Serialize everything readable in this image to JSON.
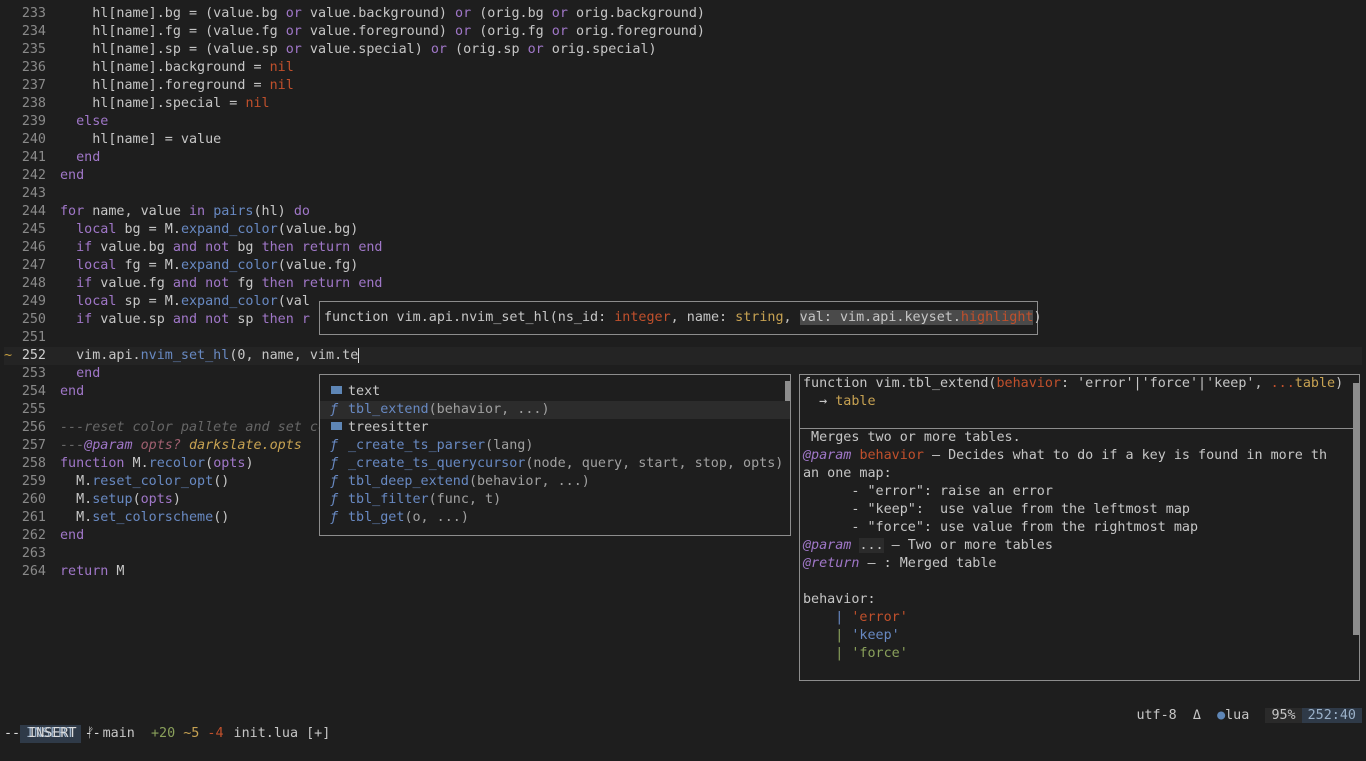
{
  "editor": {
    "lines": [
      {
        "n": "233",
        "html": "    hl[name].bg = (value.bg <span class=\"k\">or</span> value.background) <span class=\"k\">or</span> (orig.bg <span class=\"k\">or</span> orig.background)"
      },
      {
        "n": "234",
        "html": "    hl[name].fg = (value.fg <span class=\"k\">or</span> value.foreground) <span class=\"k\">or</span> (orig.fg <span class=\"k\">or</span> orig.foreground)"
      },
      {
        "n": "235",
        "html": "    hl[name].sp = (value.sp <span class=\"k\">or</span> value.special) <span class=\"k\">or</span> (orig.sp <span class=\"k\">or</span> orig.special)"
      },
      {
        "n": "236",
        "html": "    hl[name].background = <span class=\"b\">nil</span>"
      },
      {
        "n": "237",
        "html": "    hl[name].foreground = <span class=\"b\">nil</span>"
      },
      {
        "n": "238",
        "html": "    hl[name].special = <span class=\"b\">nil</span>"
      },
      {
        "n": "239",
        "html": "  <span class=\"k\">else</span>"
      },
      {
        "n": "240",
        "html": "    hl[name] = value"
      },
      {
        "n": "241",
        "html": "  <span class=\"k\">end</span>"
      },
      {
        "n": "242",
        "html": "<span class=\"k\">end</span>"
      },
      {
        "n": "243",
        "html": ""
      },
      {
        "n": "244",
        "html": "<span class=\"k\">for</span> name, value <span class=\"k\">in</span> <span class=\"f\">pairs</span>(hl) <span class=\"k\">do</span>"
      },
      {
        "n": "245",
        "html": "  <span class=\"k\">local</span> bg = M.<span class=\"f\">expand_color</span>(value.bg)"
      },
      {
        "n": "246",
        "html": "  <span class=\"k\">if</span> value.bg <span class=\"k\">and</span> <span class=\"k\">not</span> bg <span class=\"k\">then</span> <span class=\"k\">return</span> <span class=\"k\">end</span>"
      },
      {
        "n": "247",
        "html": "  <span class=\"k\">local</span> fg = M.<span class=\"f\">expand_color</span>(value.fg)"
      },
      {
        "n": "248",
        "html": "  <span class=\"k\">if</span> value.fg <span class=\"k\">and</span> <span class=\"k\">not</span> fg <span class=\"k\">then</span> <span class=\"k\">return</span> <span class=\"k\">end</span>"
      },
      {
        "n": "249",
        "html": "  <span class=\"k\">local</span> sp = M.<span class=\"f\">expand_color</span>(val"
      },
      {
        "n": "250",
        "html": "  <span class=\"k\">if</span> value.sp <span class=\"k\">and</span> <span class=\"k\">not</span> sp <span class=\"k\">then</span> <span class=\"k\">r</span>"
      },
      {
        "n": "251",
        "html": ""
      },
      {
        "n": "252",
        "html": "  vim.api.<span class=\"f\">nvim_set_hl</span>(<span class=\"dim\">0</span>, name, vim.te<span class=\"cursor\"></span>",
        "sign": "~",
        "cur": true
      },
      {
        "n": "253",
        "html": "  <span class=\"k\">end</span>"
      },
      {
        "n": "254",
        "html": "<span class=\"k\">end</span>"
      },
      {
        "n": "255",
        "html": ""
      },
      {
        "n": "256",
        "html": "<span class=\"c\">---reset color pallete and set co</span>"
      },
      {
        "n": "257",
        "html": "<span class=\"c\">---</span><span class=\"ann\">@param</span> <span class=\"ca\">opts?</span> <span class=\"ct\">darkslate.opts</span>"
      },
      {
        "n": "258",
        "html": "<span class=\"k\">function</span> M.<span class=\"f\">recolor</span>(<span class=\"pl\">opts</span>)"
      },
      {
        "n": "259",
        "html": "  M.<span class=\"f\">reset_color_opt</span>()"
      },
      {
        "n": "260",
        "html": "  M.<span class=\"f\">setup</span>(<span class=\"pl\">opts</span>)"
      },
      {
        "n": "261",
        "html": "  M.<span class=\"f\">set_colorscheme</span>()"
      },
      {
        "n": "262",
        "html": "<span class=\"k\">end</span>"
      },
      {
        "n": "263",
        "html": ""
      },
      {
        "n": "264",
        "html": "<span class=\"k\">return</span> M"
      }
    ]
  },
  "signature": {
    "prefix": "function vim.api.nvim_set_hl(",
    "p1_name": "ns_id: ",
    "p1_type": "integer",
    "sep1": ", ",
    "p2_name": "name: ",
    "p2_type": "string",
    "sep2": ", ",
    "p3_name": "val: ",
    "p3_type_a": "vim.api.keyset.",
    "p3_type_b": "highlight",
    "suffix": ")"
  },
  "completion": {
    "items": [
      {
        "kind": "text",
        "label": "text",
        "args": ""
      },
      {
        "kind": "function",
        "label": "tbl_extend",
        "args": "(behavior, ...)",
        "selected": true
      },
      {
        "kind": "text",
        "label": "treesitter",
        "args": ""
      },
      {
        "kind": "function",
        "label": "_create_ts_parser",
        "args": "(lang)"
      },
      {
        "kind": "function",
        "label": "_create_ts_querycursor",
        "args": "(node, query, start, stop, opts)"
      },
      {
        "kind": "function",
        "label": "tbl_deep_extend",
        "args": "(behavior, ...)"
      },
      {
        "kind": "function",
        "label": "tbl_filter",
        "args": "(func, t)"
      },
      {
        "kind": "function",
        "label": "tbl_get",
        "args": "(o, ...)"
      }
    ]
  },
  "doc": {
    "sig_line1_a": "function vim.tbl_extend(",
    "sig_param": "behavior",
    "sig_colon": ": ",
    "sig_enum": "'error'|'force'|'keep'",
    "sig_sep": ", ",
    "sig_rest": "...",
    "sig_table": "table",
    "sig_close": ")",
    "sig_line2_arrow": "  → ",
    "sig_line2_type": "table",
    "desc": " Merges two or more tables.",
    "param1_tag": "@param",
    "param1_name": "behavior",
    "param1_text": " — Decides what to do if a key is found in more th",
    "param1_cont": "an one map:",
    "opt1": "      - \"error\": raise an error",
    "opt2": "      - \"keep\":  use value from the leftmost map",
    "opt3": "      - \"force\": use value from the rightmost map",
    "param2_tag": "@param",
    "param2_name": "...",
    "param2_text": " — Two or more tables",
    "return_tag": "@return",
    "return_text": " — : Merged table",
    "enum_label": "behavior:",
    "enum1": "'error'",
    "enum2": "'keep'",
    "enum3": "'force'",
    "enum_bar": "|"
  },
  "status": {
    "mode": "INSERT",
    "branch_icon": "ᚠ",
    "branch": "main",
    "added": "+20",
    "changed": "~5",
    "removed": "-4",
    "file": "init.lua [+]",
    "encoding": "utf-8",
    "delta_icon": "Δ",
    "filetype": "lua",
    "percent": "95%",
    "position": "252:40"
  },
  "cmdline": "-- INSERT --",
  "colors": {
    "background": "#1e1e1e",
    "keyword": "#a077c8",
    "function": "#6889c2",
    "nil": "#c0502c",
    "string": "#8aa15b",
    "type": "#c7a252"
  }
}
